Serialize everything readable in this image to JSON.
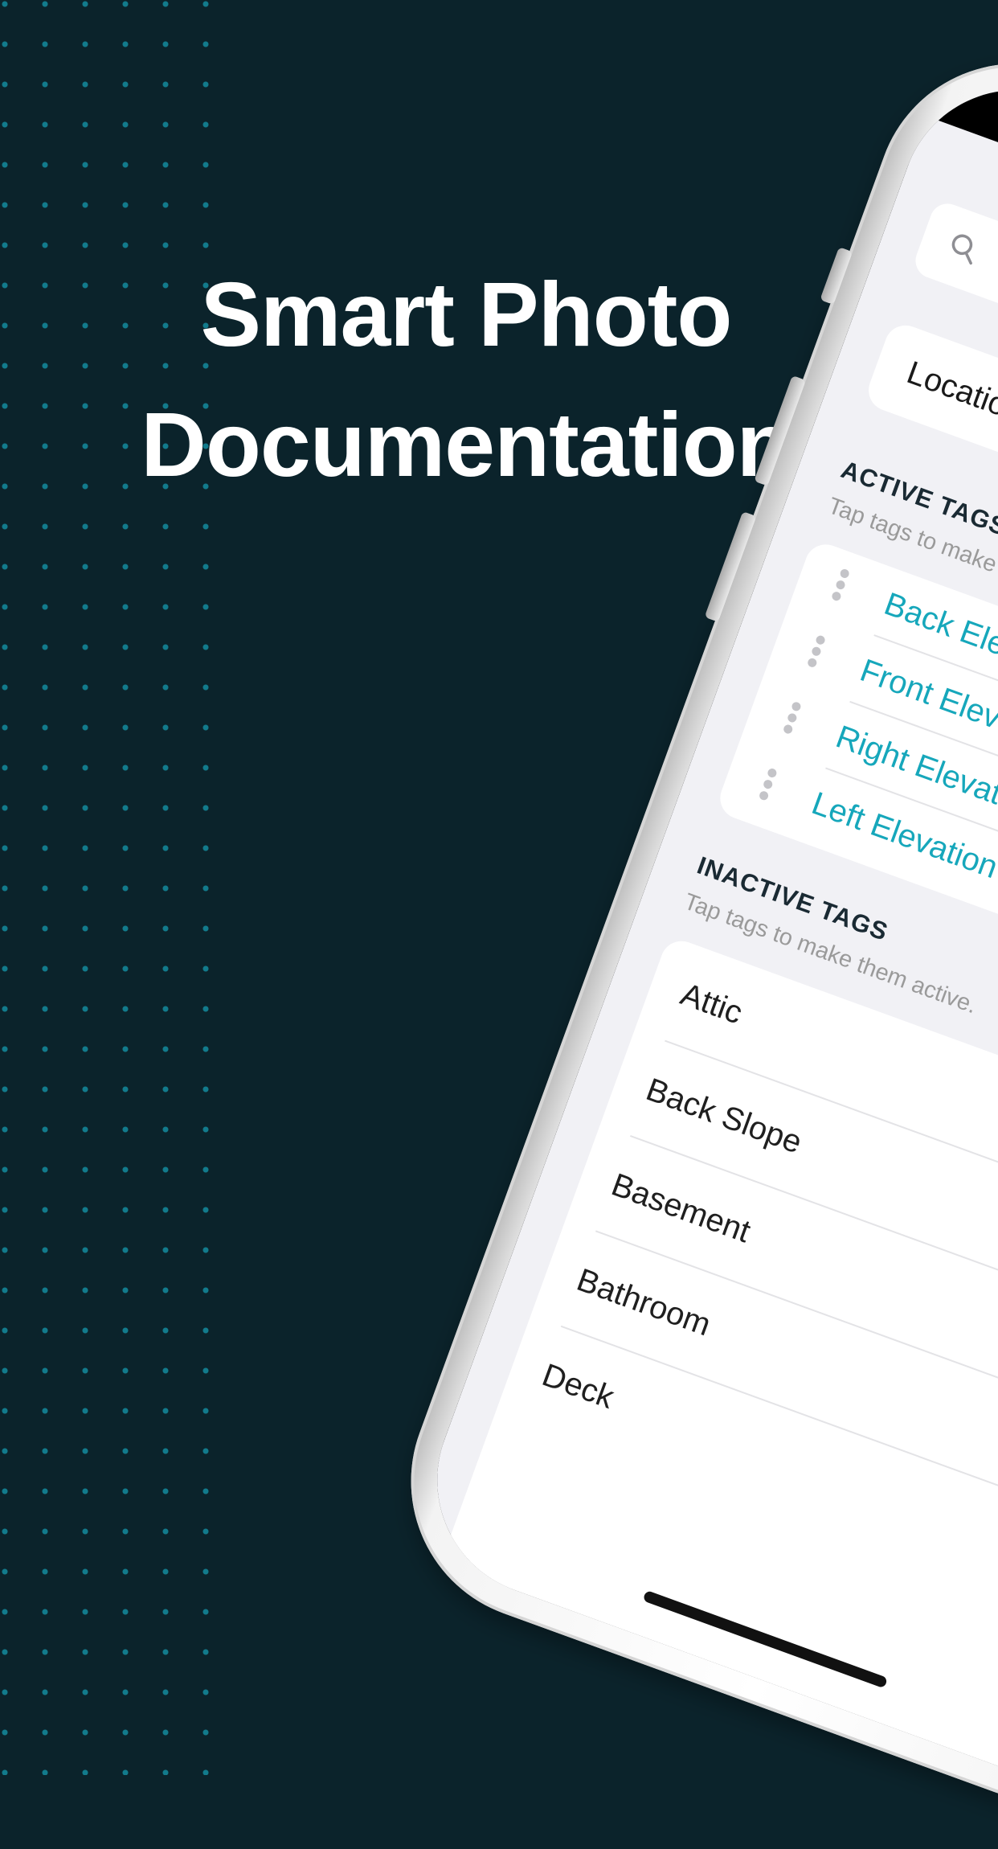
{
  "headline": {
    "line1": "Smart Photo",
    "line2": "Documentation"
  },
  "colors": {
    "background": "#0b232b",
    "dot_pattern": "#127b8c",
    "headline_text": "#ffffff",
    "active_tag": "#16a7bb",
    "inactive_tag": "#1f1f1f"
  },
  "app": {
    "search": {
      "icon": "search-icon",
      "placeholder": ""
    },
    "location": {
      "label": "Location"
    },
    "active_tags": {
      "title": "ACTIVE TAGS",
      "hint": "Tap tags to make t",
      "items": [
        {
          "label": "Back Elevation"
        },
        {
          "label": "Front Elevation"
        },
        {
          "label": "Right Elevation"
        },
        {
          "label": "Left Elevation"
        }
      ]
    },
    "inactive_tags": {
      "title": "INACTIVE TAGS",
      "hint": "Tap tags to make them active.",
      "items": [
        {
          "label": "Attic"
        },
        {
          "label": "Back Slope"
        },
        {
          "label": "Basement"
        },
        {
          "label": "Bathroom"
        },
        {
          "label": "Deck"
        }
      ]
    }
  }
}
